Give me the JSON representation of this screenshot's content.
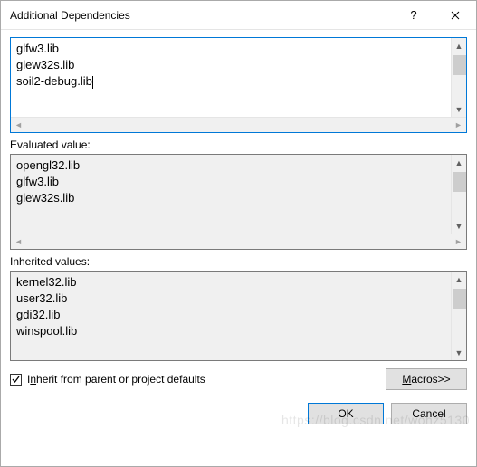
{
  "window": {
    "title": "Additional Dependencies"
  },
  "editor": {
    "lines": [
      "glfw3.lib",
      "glew32s.lib",
      "soil2-debug.lib"
    ]
  },
  "evaluated": {
    "label": "Evaluated value:",
    "lines": [
      "opengl32.lib",
      "glfw3.lib",
      "glew32s.lib"
    ]
  },
  "inherited": {
    "label": "Inherited values:",
    "lines": [
      "kernel32.lib",
      "user32.lib",
      "gdi32.lib",
      "winspool.lib"
    ]
  },
  "inherit_checkbox": {
    "checked": true,
    "label_pre": "I",
    "label_underline": "n",
    "label_post": "herit from parent or project defaults"
  },
  "buttons": {
    "macros_pre": "",
    "macros_underline": "M",
    "macros_post": "acros>>",
    "ok": "OK",
    "cancel": "Cancel"
  },
  "watermark": "https://blog.csdn.net/wohz5130"
}
